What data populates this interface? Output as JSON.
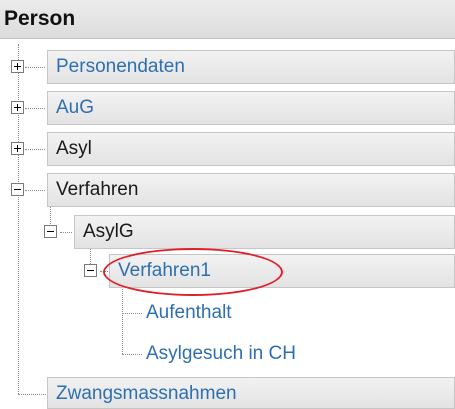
{
  "panel": {
    "title": "Person"
  },
  "tree": {
    "personendaten": "Personendaten",
    "aug": "AuG",
    "asyl": "Asyl",
    "verfahren": "Verfahren",
    "asylg": "AsylG",
    "verfahren1": "Verfahren1",
    "aufenthalt": "Aufenthalt",
    "asylgesuch": "Asylgesuch in CH",
    "zwangsmassnahmen": "Zwangsmassnahmen"
  },
  "colors": {
    "link": "#2e6fb0",
    "highlight": "#e0212b"
  }
}
